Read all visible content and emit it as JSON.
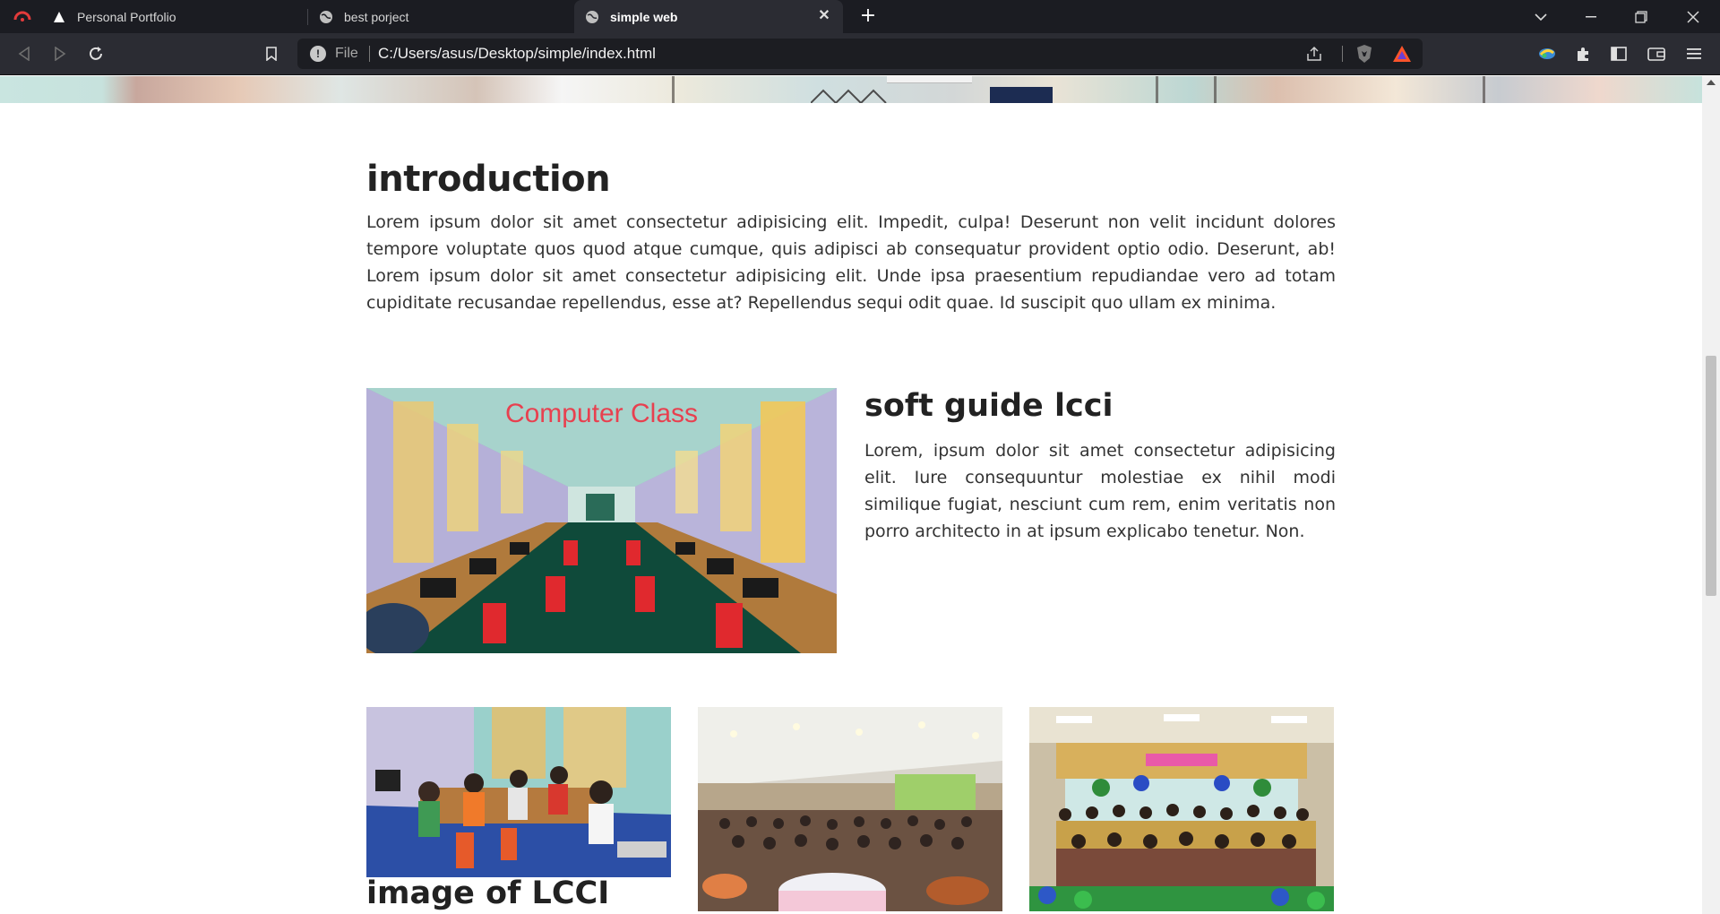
{
  "browser": {
    "tabs": [
      {
        "title": "Personal Portfolio",
        "icon": "portfolio-favicon",
        "active": false
      },
      {
        "title": "best porject",
        "icon": "globe-icon",
        "active": false
      },
      {
        "title": "simple web",
        "icon": "globe-icon",
        "active": true
      }
    ],
    "address": {
      "scheme_label": "File",
      "url": "C:/Users/asus/Desktop/simple/index.html"
    }
  },
  "page": {
    "intro": {
      "title": "introduction",
      "text": "Lorem ipsum dolor sit amet consectetur adipisicing elit. Impedit, culpa! Deserunt non velit incidunt dolores tempore voluptate quos quod atque cumque, quis adipisci ab consequatur provident optio odio. Deserunt, ab! Lorem ipsum dolor sit amet consectetur adipisicing elit. Unde ipsa praesentium repudiandae vero ad totam cupiditate recusandae repellendus, esse at? Repellendus sequi odit quae. Id suscipit quo ullam ex minima."
    },
    "feature": {
      "image_caption": "Computer Class",
      "title": "soft guide lcci",
      "text": "Lorem, ipsum dolor sit amet consectetur adipisicing elit. Iure consequuntur molestiae ex nihil modi similique fugiat, nesciunt cum rem, enim veritatis non porro architecto in at ipsum explicabo tenetur. Non."
    },
    "gallery": {
      "caption": "image of LCCI"
    }
  },
  "colors": {
    "tabbar_bg": "#1b1c22",
    "toolbar_bg": "#2b2c33",
    "caption_red": "#e8404f",
    "brave_orange": "#fb542b"
  }
}
